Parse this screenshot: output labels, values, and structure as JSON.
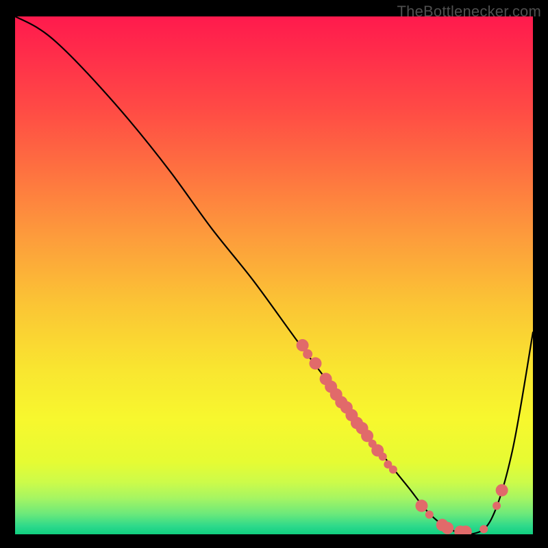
{
  "watermark": {
    "text": "TheBottlenecker.com"
  },
  "gradient": {
    "stops": [
      {
        "offset": 0.0,
        "color": "#ff1a4d"
      },
      {
        "offset": 0.08,
        "color": "#ff2f4a"
      },
      {
        "offset": 0.18,
        "color": "#ff4b45"
      },
      {
        "offset": 0.3,
        "color": "#fe7240"
      },
      {
        "offset": 0.42,
        "color": "#fd9a3c"
      },
      {
        "offset": 0.55,
        "color": "#fbc335"
      },
      {
        "offset": 0.68,
        "color": "#f9e530"
      },
      {
        "offset": 0.78,
        "color": "#f7f82e"
      },
      {
        "offset": 0.86,
        "color": "#e6fb33"
      },
      {
        "offset": 0.9,
        "color": "#ccfb4a"
      },
      {
        "offset": 0.93,
        "color": "#a6f562"
      },
      {
        "offset": 0.96,
        "color": "#6de97a"
      },
      {
        "offset": 0.985,
        "color": "#2cd98b"
      },
      {
        "offset": 1.0,
        "color": "#10cf80"
      }
    ]
  },
  "colors": {
    "line": "#000000",
    "dot_fill": "#e16a6a",
    "dot_stroke": "#c94f4f"
  },
  "chart_data": {
    "type": "line",
    "title": "",
    "xlabel": "",
    "ylabel": "",
    "xlim": [
      0,
      100
    ],
    "ylim": [
      0,
      100
    ],
    "series": [
      {
        "name": "curve",
        "x": [
          0,
          4,
          8,
          14,
          22,
          30,
          38,
          46,
          54,
          60,
          66,
          72,
          76,
          80,
          84,
          88,
          92,
          96,
          100
        ],
        "y": [
          100,
          98,
          95,
          89,
          80,
          70,
          59,
          49,
          38,
          30,
          22,
          14,
          9,
          4,
          1,
          0,
          3,
          16,
          39
        ],
        "stroke": "#000000"
      }
    ],
    "markers": {
      "name": "highlight-dots",
      "points": [
        {
          "x": 55.5,
          "y": 36.5,
          "r": 9
        },
        {
          "x": 56.5,
          "y": 34.8,
          "r": 7
        },
        {
          "x": 58.0,
          "y": 33.0,
          "r": 9
        },
        {
          "x": 60.0,
          "y": 30.0,
          "r": 9
        },
        {
          "x": 61.0,
          "y": 28.5,
          "r": 9
        },
        {
          "x": 62.0,
          "y": 27.0,
          "r": 9
        },
        {
          "x": 63.0,
          "y": 25.5,
          "r": 9
        },
        {
          "x": 64.0,
          "y": 24.5,
          "r": 9
        },
        {
          "x": 65.0,
          "y": 23.0,
          "r": 9
        },
        {
          "x": 66.0,
          "y": 21.5,
          "r": 9
        },
        {
          "x": 67.0,
          "y": 20.5,
          "r": 9
        },
        {
          "x": 68.0,
          "y": 19.0,
          "r": 9
        },
        {
          "x": 69.0,
          "y": 17.5,
          "r": 6
        },
        {
          "x": 70.0,
          "y": 16.2,
          "r": 9
        },
        {
          "x": 71.0,
          "y": 15.0,
          "r": 6
        },
        {
          "x": 72.0,
          "y": 13.5,
          "r": 6
        },
        {
          "x": 73.0,
          "y": 12.5,
          "r": 6
        },
        {
          "x": 78.5,
          "y": 5.5,
          "r": 9
        },
        {
          "x": 80.0,
          "y": 3.8,
          "r": 6
        },
        {
          "x": 82.5,
          "y": 1.8,
          "r": 9
        },
        {
          "x": 83.5,
          "y": 1.2,
          "r": 9
        },
        {
          "x": 86.0,
          "y": 0.5,
          "r": 9
        },
        {
          "x": 87.0,
          "y": 0.5,
          "r": 9
        },
        {
          "x": 90.5,
          "y": 1.0,
          "r": 6
        },
        {
          "x": 93.0,
          "y": 5.5,
          "r": 6
        },
        {
          "x": 94.0,
          "y": 8.5,
          "r": 9
        }
      ],
      "fill": "#e16a6a",
      "stroke": "#c94f4f"
    }
  }
}
